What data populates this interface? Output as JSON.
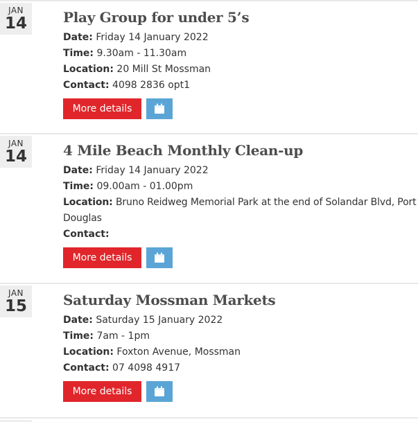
{
  "labels": {
    "date": "Date:",
    "time": "Time:",
    "location": "Location:",
    "contact": "Contact:"
  },
  "events": [
    {
      "month": "JAN",
      "day": "14",
      "title": "Play Group for under 5’s",
      "date": "Friday 14 January 2022",
      "time": "9.30am - 11.30am",
      "location": "20 Mill St Mossman",
      "contact": "4098 2836 opt1",
      "more_label": "More details",
      "calendar_icon": "calendar-icon"
    },
    {
      "month": "JAN",
      "day": "14",
      "title": "4 Mile Beach Monthly Clean-up",
      "date": "Friday 14 January 2022",
      "time": "09.00am - 01.00pm",
      "location": "Bruno Reidweg Memorial Park at the end of Solandar Blvd, Port Douglas",
      "contact": "",
      "more_label": "More details",
      "calendar_icon": "calendar-icon"
    },
    {
      "month": "JAN",
      "day": "15",
      "title": "Saturday Mossman Markets",
      "date": "Saturday 15 January 2022",
      "time": "7am - 1pm",
      "location": "Foxton Avenue, Mossman",
      "contact": "07 4098 4917",
      "more_label": "More details",
      "calendar_icon": "calendar-icon"
    }
  ],
  "colors": {
    "more_button": "#e0262b",
    "calendar_button": "#5aa5d6",
    "date_badge": "#eeeeee"
  }
}
